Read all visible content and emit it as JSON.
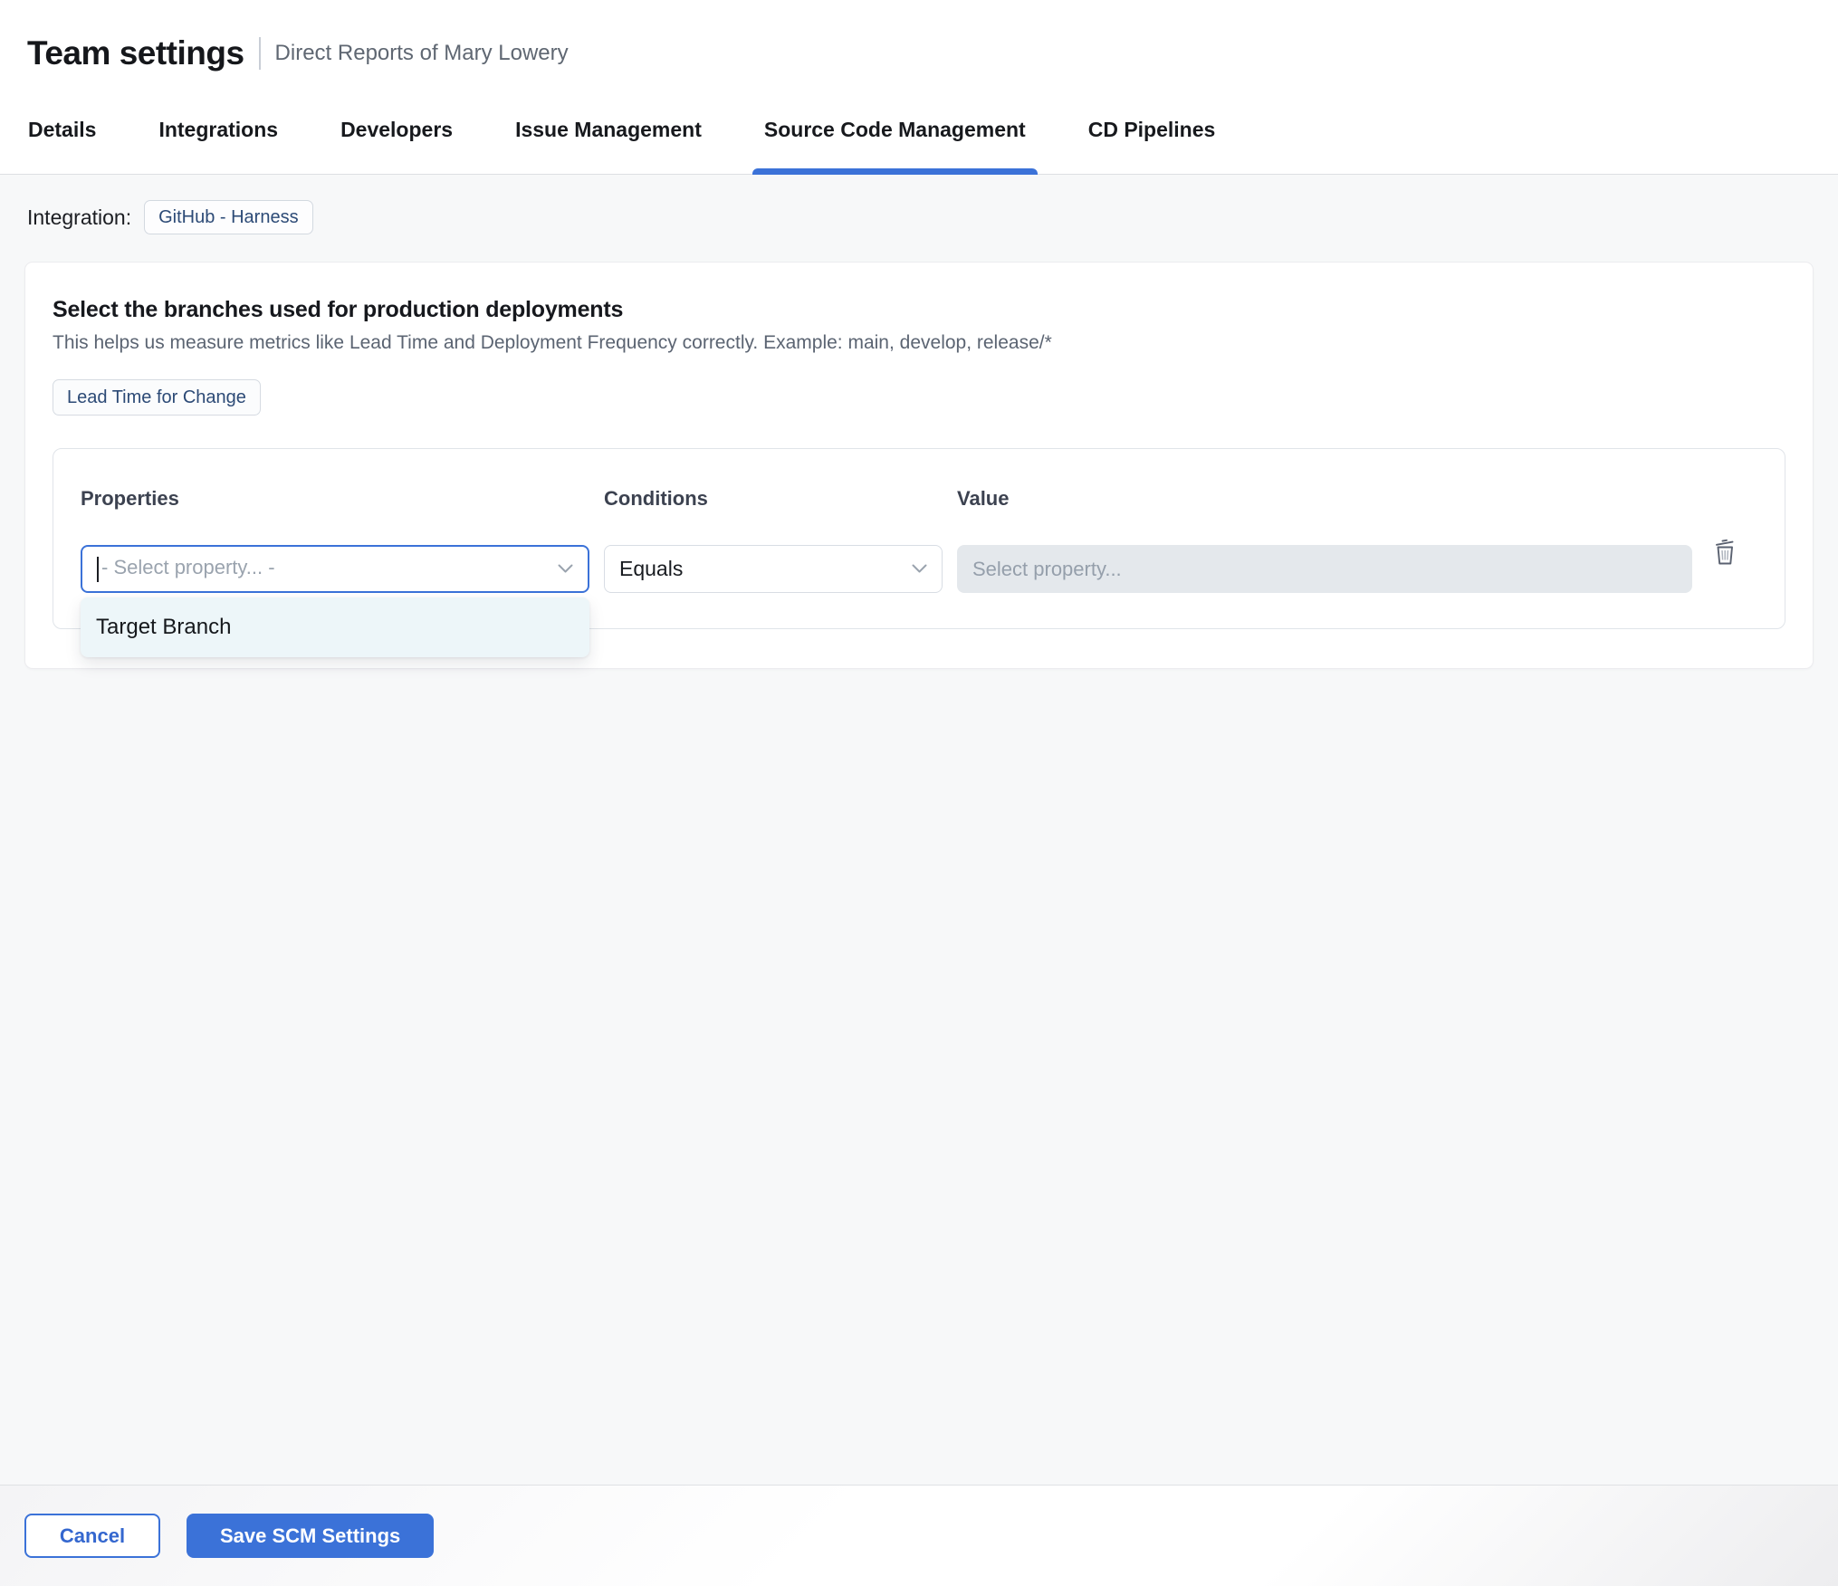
{
  "header": {
    "title": "Team settings",
    "subtitle": "Direct Reports of Mary Lowery"
  },
  "tabs": [
    {
      "label": "Details",
      "active": false
    },
    {
      "label": "Integrations",
      "active": false
    },
    {
      "label": "Developers",
      "active": false
    },
    {
      "label": "Issue Management",
      "active": false
    },
    {
      "label": "Source Code Management",
      "active": true
    },
    {
      "label": "CD Pipelines",
      "active": false
    }
  ],
  "integration": {
    "label": "Integration:",
    "chip": "GitHub - Harness"
  },
  "card": {
    "title": "Select the branches used for production deployments",
    "subtitle": "This helps us measure metrics like Lead Time and Deployment Frequency correctly. Example: main, develop, release/*",
    "metric_chip": "Lead Time for Change",
    "rule": {
      "properties_label": "Properties",
      "conditions_label": "Conditions",
      "value_label": "Value",
      "property_placeholder": "- Select property... -",
      "condition_value": "Equals",
      "value_placeholder": "Select property...",
      "dropdown_options": [
        "Target Branch"
      ]
    }
  },
  "footer": {
    "cancel_label": "Cancel",
    "save_label": "Save SCM Settings"
  },
  "colors": {
    "accent_blue": "#3b72d8",
    "chip_text": "#2c4a76",
    "dropdown_bg": "#edf6f9",
    "disabled_input_bg": "#e4e8ec",
    "content_bg": "#f7f8f9"
  }
}
